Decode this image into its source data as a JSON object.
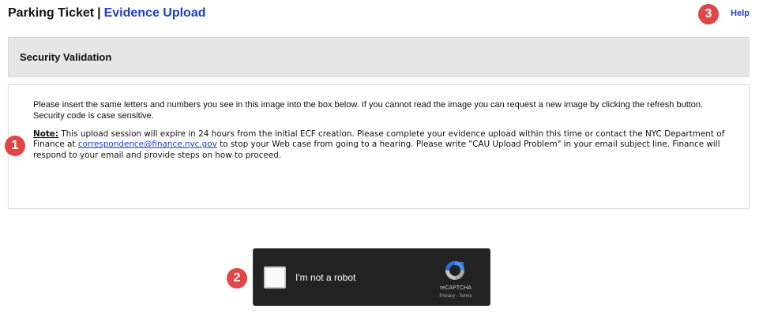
{
  "header": {
    "title": "Parking Ticket",
    "separator": "|",
    "section_link": "Evidence Upload",
    "help_link": "Help"
  },
  "markers": [
    "1",
    "2",
    "3"
  ],
  "panel": {
    "heading": "Security Validation",
    "instructions": "Please insert the same letters and numbers you see in this image into the box below. If you cannot read the image you can request a new image by clicking the refresh button. Security code is case sensitive.",
    "note_label": "Note:",
    "note_text_1": " This upload session will expire in 24 hours from the initial ECF creation. Please complete your evidence upload within this time or contact the NYC Department of Finance at ",
    "email": "correspondence@finance.nyc.gov",
    "note_text_2": " to stop your Web case from going to a hearing. Please write \"CAU Upload Problem\" in your email subject line. Finance will respond to your email and provide steps on how to proceed."
  },
  "captcha": {
    "label": "I'm not a robot",
    "brand": "reCAPTCHA",
    "privacy": "Privacy",
    "terms_sep": " - ",
    "terms": "Terms",
    "logo_icon": "recaptcha-logo-icon"
  },
  "colors": {
    "link": "#1a3fd8",
    "marker": "#e04646",
    "panel_header_bg": "#e6e6e6",
    "captcha_bg": "#222222"
  }
}
